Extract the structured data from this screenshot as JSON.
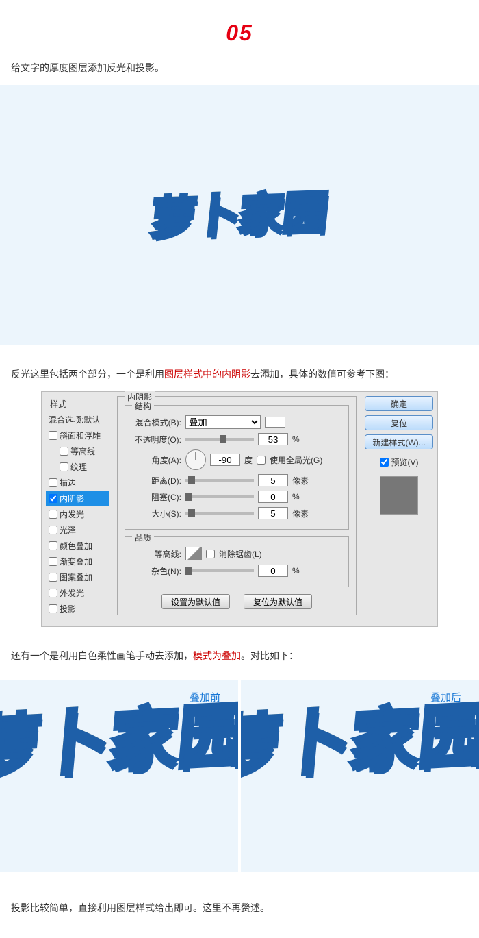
{
  "step_number": "05",
  "intro": "给文字的厚度图层添加反光和投影。",
  "para2_a": "反光这里包括两个部分，一个是利用",
  "para2_red": "图层样式中的内阴影",
  "para2_b": "去添加，具体的数值可参考下图：",
  "para3_a": "还有一个是利用白色柔性画笔手动去添加，",
  "para3_red": "模式为叠加",
  "para3_b": "。对比如下：",
  "before_caption": "叠加前",
  "after_caption": "叠加后",
  "last_para": "投影比较简单，直接利用图层样式给出即可。这里不再赘述。",
  "styles": {
    "header": "样式",
    "blend": "混合选项:默认",
    "items": [
      "斜面和浮雕",
      "等高线",
      "纹理",
      "描边",
      "内阴影",
      "内发光",
      "光泽",
      "颜色叠加",
      "渐变叠加",
      "图案叠加",
      "外发光",
      "投影"
    ]
  },
  "dialog": {
    "inner_shadow": "内阴影",
    "structure": "结构",
    "blend_mode": "混合模式(B):",
    "blend_value": "叠加",
    "opacity": "不透明度(O):",
    "opacity_val": "53",
    "pct": "%",
    "angle": "角度(A):",
    "angle_val": "-90",
    "deg": "度",
    "global": "使用全局光(G)",
    "distance": "距离(D):",
    "distance_val": "5",
    "px": "像素",
    "choke": "阻塞(C):",
    "choke_val": "0",
    "size": "大小(S):",
    "size_val": "5",
    "quality": "品质",
    "contour": "等高线:",
    "antialias": "消除锯齿(L)",
    "noise": "杂色(N):",
    "noise_val": "0",
    "btn_default": "设置为默认值",
    "btn_reset": "复位为默认值",
    "ok": "确定",
    "cancel": "复位",
    "new": "新建样式(W)...",
    "preview": "预览(V)"
  },
  "logo": {
    "yellow": "萝卜",
    "blue": "家园"
  }
}
